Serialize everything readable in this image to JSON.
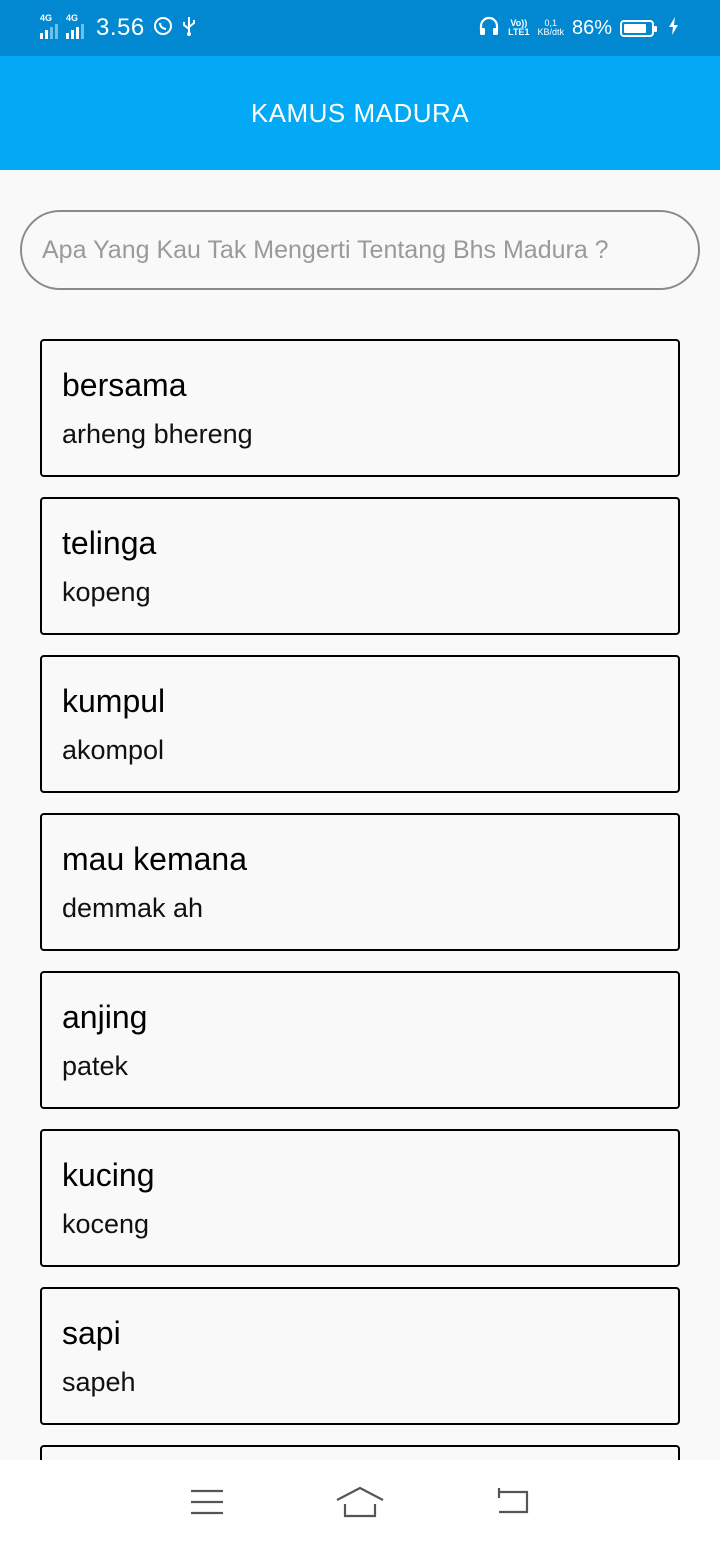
{
  "status_bar": {
    "net1": "4G",
    "net2": "4G",
    "time": "3.56",
    "whatsapp_icon": "whatsapp-icon",
    "usb_icon": "usb-icon",
    "headphone_icon": "headphone-icon",
    "volte_top": "Vo))",
    "volte_bottom": "LTE1",
    "speed_top": "0,1",
    "speed_bottom": "KB/dtk",
    "battery_text": "86%",
    "battery_level": 0.86
  },
  "app_bar": {
    "title": "KAMUS MADURA"
  },
  "search": {
    "placeholder": "Apa Yang Kau Tak Mengerti Tentang Bhs Madura ?",
    "value": ""
  },
  "entries": [
    {
      "word": "bersama",
      "translation": "arheng bhereng"
    },
    {
      "word": "telinga",
      "translation": "kopeng"
    },
    {
      "word": "kumpul",
      "translation": "akompol"
    },
    {
      "word": "mau kemana",
      "translation": "demmak ah"
    },
    {
      "word": "anjing",
      "translation": "patek"
    },
    {
      "word": "kucing",
      "translation": "koceng"
    },
    {
      "word": "sapi",
      "translation": "sapeh"
    },
    {
      "word": "",
      "translation": ""
    }
  ],
  "nav_bar": {
    "menu_icon": "menu-icon",
    "home_icon": "home-icon",
    "back_icon": "back-icon"
  },
  "colors": {
    "status_bar": "#0288d1",
    "app_bar": "#03a9f4",
    "background": "#f9f9f9"
  }
}
